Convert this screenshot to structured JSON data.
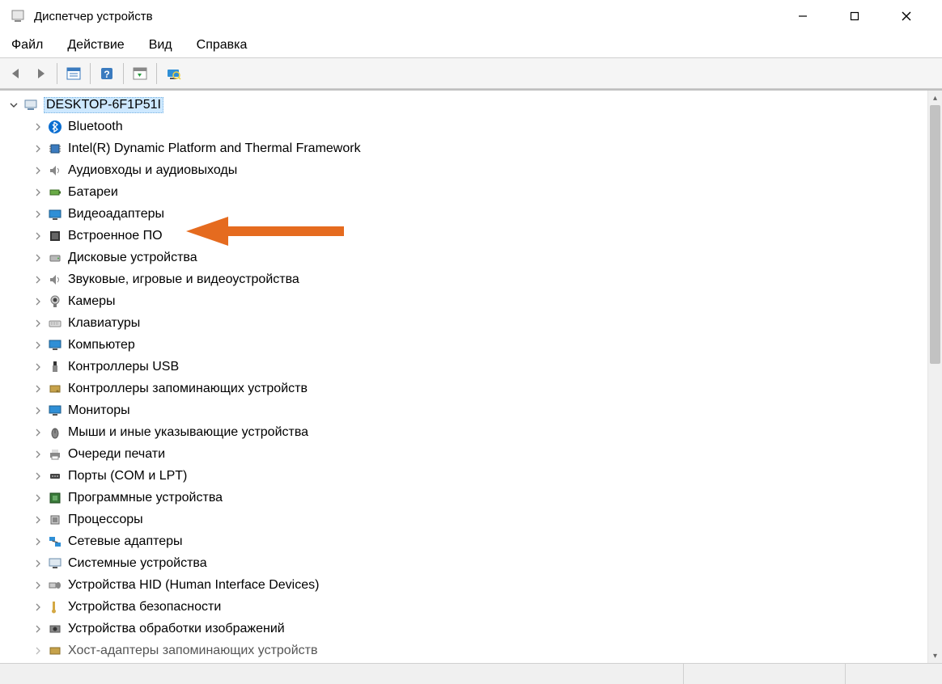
{
  "window": {
    "title": "Диспетчер устройств"
  },
  "menu": {
    "file": "Файл",
    "action": "Действие",
    "view": "Вид",
    "help": "Справка"
  },
  "tree": {
    "root": "DESKTOP-6F1P51I",
    "items": [
      {
        "label": "Bluetooth",
        "icon": "bluetooth"
      },
      {
        "label": "Intel(R) Dynamic Platform and Thermal Framework",
        "icon": "chip"
      },
      {
        "label": "Аудиовходы и аудиовыходы",
        "icon": "speaker"
      },
      {
        "label": "Батареи",
        "icon": "battery"
      },
      {
        "label": "Видеоадаптеры",
        "icon": "display"
      },
      {
        "label": "Встроенное ПО",
        "icon": "firmware"
      },
      {
        "label": "Дисковые устройства",
        "icon": "disk"
      },
      {
        "label": "Звуковые, игровые и видеоустройства",
        "icon": "speaker"
      },
      {
        "label": "Камеры",
        "icon": "camera"
      },
      {
        "label": "Клавиатуры",
        "icon": "keyboard"
      },
      {
        "label": "Компьютер",
        "icon": "monitor"
      },
      {
        "label": "Контроллеры USB",
        "icon": "usb"
      },
      {
        "label": "Контроллеры запоминающих устройств",
        "icon": "storage"
      },
      {
        "label": "Мониторы",
        "icon": "monitor"
      },
      {
        "label": "Мыши и иные указывающие устройства",
        "icon": "mouse"
      },
      {
        "label": "Очереди печати",
        "icon": "printer"
      },
      {
        "label": "Порты (COM и LPT)",
        "icon": "port"
      },
      {
        "label": "Программные устройства",
        "icon": "software"
      },
      {
        "label": "Процессоры",
        "icon": "cpu"
      },
      {
        "label": "Сетевые адаптеры",
        "icon": "network"
      },
      {
        "label": "Системные устройства",
        "icon": "system"
      },
      {
        "label": "Устройства HID (Human Interface Devices)",
        "icon": "hid"
      },
      {
        "label": "Устройства безопасности",
        "icon": "security"
      },
      {
        "label": "Устройства обработки изображений",
        "icon": "imaging"
      },
      {
        "label": "Хост-адаптеры запоминающих устройств",
        "icon": "storage"
      }
    ]
  },
  "annotation": {
    "arrow_color": "#E56B1F"
  }
}
